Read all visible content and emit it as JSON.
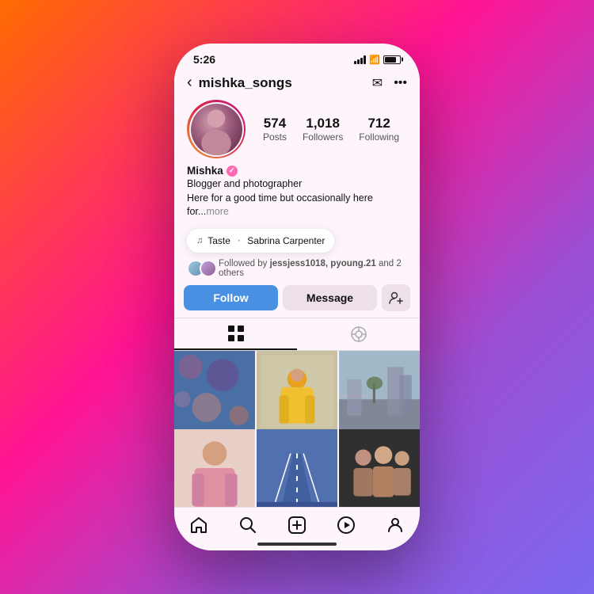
{
  "background": {
    "gradient": "linear-gradient(135deg, #ff6b00 0%, #ff1493 40%, #9b4fd4 70%, #7b68ee 100%)"
  },
  "status_bar": {
    "time": "5:26"
  },
  "header": {
    "back_label": "‹",
    "username": "mishka_songs",
    "send_icon": "send",
    "more_icon": "more"
  },
  "profile": {
    "display_name": "Mishka",
    "verified": true,
    "bio_line1": "Blogger and photographer",
    "bio_line2": "Here for a good time but occasionally here for...",
    "bio_more": "more",
    "stats": {
      "posts_count": "574",
      "posts_label": "Posts",
      "followers_count": "1,018",
      "followers_label": "Followers",
      "following_count": "712",
      "following_label": "Following"
    }
  },
  "music": {
    "note": "♪",
    "song": "Taste",
    "dot": "·",
    "artist": "Sabrina Carpenter"
  },
  "followed_by": {
    "text": "Followed by ",
    "names": "jessjess1018, pyoung.21",
    "suffix": " and 2 others"
  },
  "buttons": {
    "follow": "Follow",
    "message": "Message",
    "add_person": "+"
  },
  "tabs": {
    "grid_label": "grid",
    "tag_label": "tag"
  },
  "bottom_nav": {
    "home": "⌂",
    "search": "🔍",
    "add": "⊕",
    "reels": "▶",
    "profile": "👤"
  },
  "photos": [
    {
      "id": 1,
      "class": "photo-cell-1",
      "alt": "floral blue pattern"
    },
    {
      "id": 2,
      "class": "photo-cell-2",
      "alt": "person in yellow raincoat"
    },
    {
      "id": 3,
      "class": "photo-cell-3",
      "alt": "city street scene"
    },
    {
      "id": 4,
      "class": "photo-cell-4",
      "alt": "person pink outfit"
    },
    {
      "id": 5,
      "class": "photo-cell-5",
      "alt": "blue road lines"
    },
    {
      "id": 6,
      "class": "photo-cell-6",
      "alt": "group photo dark background"
    }
  ]
}
